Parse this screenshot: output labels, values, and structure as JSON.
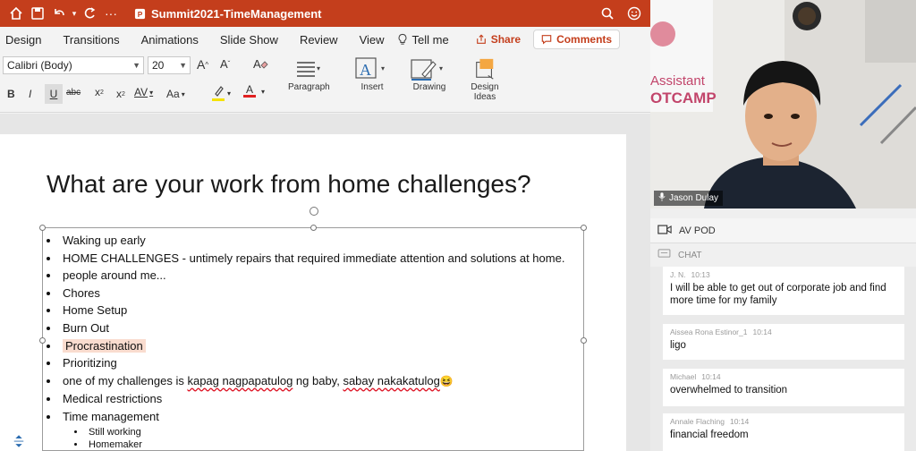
{
  "titlebar": {
    "title": "Summit2021-TimeManagement"
  },
  "menu": {
    "items": [
      "Design",
      "Transitions",
      "Animations",
      "Slide Show",
      "Review",
      "View"
    ],
    "tell_me": "Tell me",
    "share": "Share",
    "comments": "Comments"
  },
  "ribbon": {
    "font_name": "Calibri (Body)",
    "font_size": "20",
    "bold": "B",
    "italic": "I",
    "underline": "U",
    "strike": "abc",
    "superscript": "x",
    "subscript": "x",
    "spacing": "AV",
    "change_case": "Aa",
    "grow": "A",
    "shrink": "A",
    "font_color": "A",
    "paragraph": "Paragraph",
    "insert": "Insert",
    "drawing": "Drawing",
    "design_ideas": "Design Ideas"
  },
  "slide": {
    "title": "What are your work from home challenges?",
    "bullets": [
      "Waking up early",
      "HOME CHALLENGES - untimely repairs that required immediate attention and solutions at home.",
      "people around me...",
      "Chores",
      "Home Setup",
      "Burn Out",
      "Procrastination",
      "Prioritizing",
      "one of my challenges is kapag nagpapatulog ng baby, sabay nakakatulog",
      "Medical restrictions",
      "Time management"
    ],
    "sub_bullets": [
      "Still working",
      "Homemaker"
    ],
    "squiggle_words": [
      "kapag nagpapatulog",
      "sabay nakakatulog"
    ]
  },
  "video": {
    "participant": "Jason Dulay",
    "banner_line1": "Assistant",
    "banner_line2": "OTCAMP"
  },
  "pod": {
    "title": "AV POD",
    "chat_title": "CHAT"
  },
  "chat": {
    "messages": [
      {
        "author": "J. N.",
        "time": "10:13",
        "text": "I will be able to get out of corporate job and find more time for my family"
      },
      {
        "author": "Aissea Rona Estinor_1",
        "time": "10:14",
        "text": "ligo"
      },
      {
        "author": "Michael",
        "time": "10:14",
        "text": "overwhelmed to transition"
      },
      {
        "author": "Annale Flaching",
        "time": "10:14",
        "text": "financial freedom"
      }
    ]
  },
  "colors": {
    "ppt_accent": "#c43e1c",
    "highlight": "#f9dccf"
  }
}
